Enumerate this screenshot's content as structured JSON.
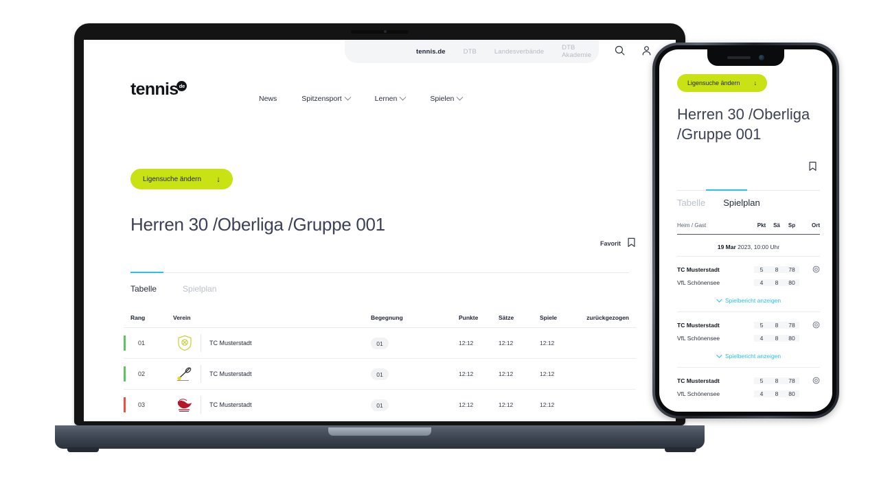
{
  "brand": {
    "accent_lime": "#c8e213",
    "accent_cyan": "#27c4e0",
    "title_color": "#3b4256",
    "positive": "#5fc45f",
    "negative": "#e8513a"
  },
  "topbar": {
    "links": [
      {
        "label": "tennis.de",
        "active": true
      },
      {
        "label": "DTB",
        "active": false
      },
      {
        "label": "Landesverbände",
        "active": false
      },
      {
        "label": "DTB Akademie",
        "active": false
      }
    ],
    "search_icon": "search-icon",
    "account_icon": "user-icon"
  },
  "logo": {
    "word": "tennis",
    "badge": "de"
  },
  "nav": [
    {
      "label": "News",
      "has_chevron": false
    },
    {
      "label": "Spitzensport",
      "has_chevron": true
    },
    {
      "label": "Lernen",
      "has_chevron": true
    },
    {
      "label": "Spielen",
      "has_chevron": true
    }
  ],
  "desktop": {
    "league_button": {
      "label": "Ligensuche ändern",
      "arrow": "↓"
    },
    "page_title": "Herren 30 /Oberliga /Gruppe 001",
    "favorite": {
      "label": "Favorit",
      "icon": "bookmark-icon"
    },
    "tabs": [
      {
        "label": "Tabelle",
        "active": true
      },
      {
        "label": "Spielplan",
        "active": false
      }
    ],
    "table": {
      "columns": [
        "Rang",
        "Verein",
        "Begegnung",
        "Punkte",
        "Sätze",
        "Spiele",
        "zurückgezogen"
      ],
      "rows": [
        {
          "rang": "01",
          "verein": "TC Musterstadt",
          "begegnung": "01",
          "punkte": "12:12",
          "saetze": "12:12",
          "spiele": "12:12",
          "zurueckgezogen": "",
          "indicator": "positive",
          "crest": "shield-crest-icon"
        },
        {
          "rang": "02",
          "verein": "TC Musterstadt",
          "begegnung": "01",
          "punkte": "12:12",
          "saetze": "12:12",
          "spiele": "12:12",
          "zurueckgezogen": "",
          "indicator": "positive",
          "crest": "racket-crest-icon"
        },
        {
          "rang": "03",
          "verein": "TC Musterstadt",
          "begegnung": "01",
          "punkte": "12:12",
          "saetze": "12:12",
          "spiele": "12:12",
          "zurueckgezogen": "",
          "indicator": "negative",
          "crest": "eagle-crest-icon"
        }
      ]
    }
  },
  "mobile": {
    "league_button": {
      "label": "Ligensuche ändern",
      "arrow": "↓"
    },
    "page_title": "Herren 30 /Oberliga /Gruppe 001",
    "bookmark_icon": "bookmark-icon",
    "tabs": [
      {
        "label": "Tabelle",
        "active": false
      },
      {
        "label": "Spielplan",
        "active": true
      }
    ],
    "table_headers": {
      "teams": "Heim /",
      "teams_secondary": " Gast",
      "pkt": "Pkt",
      "sa": "Sä",
      "sp": "Sp",
      "ort": "Ort"
    },
    "date_heading": {
      "bold": "19 Mar",
      "rest": " 2023, 10:00 Uhr"
    },
    "report_link": "Spielbericht anzeigen",
    "matches": [
      {
        "home": "TC Musterstadt",
        "away": "VfL Schönensee",
        "home_scores": [
          "5",
          "8",
          "78"
        ],
        "away_scores": [
          "4",
          "8",
          "80"
        ],
        "location_icon": "location-target-icon"
      },
      {
        "home": "TC Musterstadt",
        "away": "VfL Schönensee",
        "home_scores": [
          "5",
          "8",
          "78"
        ],
        "away_scores": [
          "4",
          "8",
          "80"
        ],
        "location_icon": "location-target-icon"
      },
      {
        "home": "TC Musterstadt",
        "away": "VfL Schönensee",
        "home_scores": [
          "5",
          "8",
          "78"
        ],
        "away_scores": [
          "4",
          "8",
          "80"
        ],
        "location_icon": "location-target-icon"
      }
    ]
  }
}
